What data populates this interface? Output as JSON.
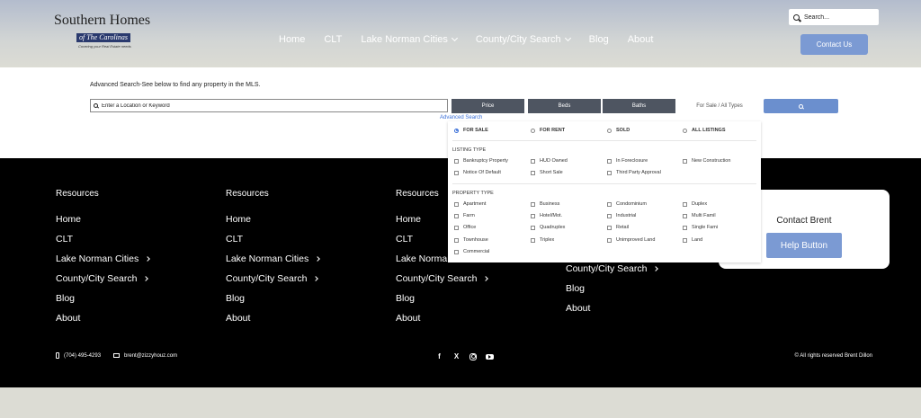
{
  "header": {
    "logo": {
      "line1": "Southern Homes",
      "line2": "of The Carolinas",
      "tagline": "Covering your Real Estate needs"
    },
    "nav": [
      {
        "label": "Home",
        "dropdown": false
      },
      {
        "label": "CLT",
        "dropdown": false
      },
      {
        "label": "Lake Norman Cities",
        "dropdown": true
      },
      {
        "label": "County/City Search",
        "dropdown": true
      },
      {
        "label": "Blog",
        "dropdown": false
      },
      {
        "label": "About",
        "dropdown": false
      }
    ],
    "search_placeholder": "Search...",
    "contact_label": "Contact Us"
  },
  "search": {
    "title": "Advanced Search-See below to find any property in the MLS.",
    "location_placeholder": "Enter a Location or Keyword",
    "price_label": "Price",
    "beds_label": "Beds",
    "baths_label": "Baths",
    "type_label": "For Sale / All Types",
    "advanced_link": "Advanced Search"
  },
  "dropdown": {
    "status_options": [
      "FOR SALE",
      "FOR RENT",
      "SOLD",
      "ALL LISTINGS"
    ],
    "selected_status": "FOR SALE",
    "listing_type_title": "LISTING TYPE",
    "listing_types": [
      "Bankruptcy Property",
      "HUD Owned",
      "In Foreclosure",
      "New Construction",
      "Notice Of Default",
      "Short Sale",
      "Third Party Approval"
    ],
    "property_type_title": "PROPERTY TYPE",
    "property_types": [
      "Apartment",
      "Business",
      "Condominium",
      "Duplex",
      "Farm",
      "Hotel/Mot.",
      "Industrial",
      "Multi Famil",
      "Office",
      "Quadruplex",
      "Retail",
      "Single Fami",
      "Townhouse",
      "Triplex",
      "Unimproved Land",
      "Land",
      "Commercial"
    ]
  },
  "footer": {
    "columns": [
      {
        "title": "Resources",
        "links": [
          "Home",
          "CLT",
          "Lake Norman Cities",
          "County/City Search",
          "Blog",
          "About"
        ]
      },
      {
        "title": "Resources",
        "links": [
          "Home",
          "CLT",
          "Lake Norman Cities",
          "County/City Search",
          "Blog",
          "About"
        ]
      },
      {
        "title": "Resources",
        "links": [
          "Home",
          "CLT",
          "Lake Norman Cities",
          "County/City Search",
          "Blog",
          "About"
        ]
      },
      {
        "title": "",
        "links": [
          "",
          "",
          "",
          "County/City Search",
          "Blog",
          "About"
        ]
      }
    ],
    "contact_card_title": "Contact Brent",
    "help_button": "Help Button",
    "phone": "(704) 495-4293",
    "email": "brent@zizzyhouz.com",
    "social_icons": [
      "facebook-icon",
      "x-icon",
      "instagram-icon",
      "youtube-icon"
    ],
    "copyright": "© All rights reserved Brent Dillon"
  },
  "colors": {
    "accent": "#7b9ad3",
    "filter_button": "#4e5561",
    "footer_bg": "#000000"
  }
}
